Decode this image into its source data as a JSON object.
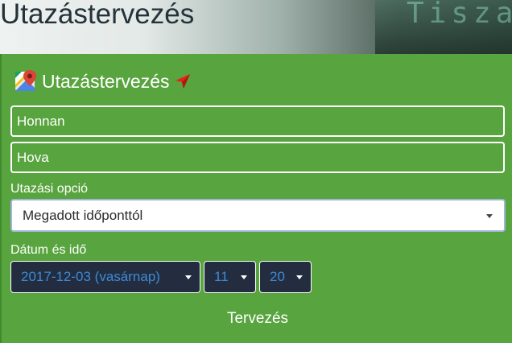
{
  "page": {
    "title": "Utazástervezés",
    "hero_background_text": "Tisza"
  },
  "widget": {
    "title": "Utazástervezés",
    "from_placeholder": "Honnan",
    "to_placeholder": "Hova",
    "option_label": "Utazási opció",
    "option_value": "Megadott időponttól",
    "datetime_label": "Dátum és idő",
    "date_value": "2017-12-03 (vasárnap)",
    "hour_value": "11",
    "minute_value": "20",
    "submit_label": "Tervezés"
  },
  "colors": {
    "panel": "#58a43e",
    "select_dark": "#232d3f",
    "select_text": "#3d8bd6",
    "title_text": "#24323a",
    "arrow": "#e8221b"
  },
  "icons": {
    "header_icon": "google-maps-icon",
    "arrow_icon": "navigation-arrow-icon"
  }
}
